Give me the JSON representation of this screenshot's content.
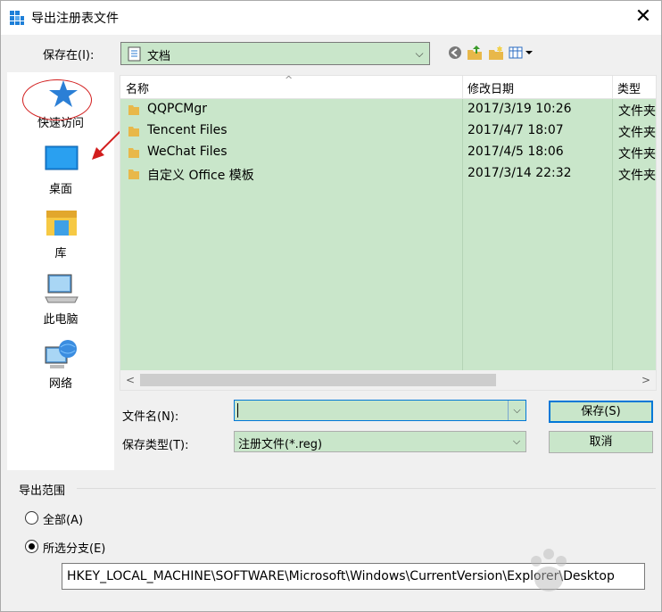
{
  "window": {
    "title": "导出注册表文件",
    "close_glyph": "✕"
  },
  "save_in": {
    "label": "保存在(I):",
    "value": "文档"
  },
  "places": [
    {
      "label": "快速访问",
      "icon": "star-icon"
    },
    {
      "label": "桌面",
      "icon": "desktop-icon"
    },
    {
      "label": "库",
      "icon": "library-icon"
    },
    {
      "label": "此电脑",
      "icon": "computer-icon"
    },
    {
      "label": "网络",
      "icon": "network-icon"
    }
  ],
  "file_list": {
    "columns": [
      "名称",
      "修改日期",
      "类型"
    ],
    "rows": [
      {
        "name": "QQPCMgr",
        "date": "2017/3/19 10:26",
        "type": "文件夹"
      },
      {
        "name": "Tencent Files",
        "date": "2017/4/7 18:07",
        "type": "文件夹"
      },
      {
        "name": "WeChat Files",
        "date": "2017/4/5 18:06",
        "type": "文件夹"
      },
      {
        "name": "自定义 Office 模板",
        "date": "2017/3/14 22:32",
        "type": "文件夹"
      }
    ]
  },
  "filename": {
    "label": "文件名(N):",
    "value": ""
  },
  "filetype": {
    "label": "保存类型(T):",
    "value": "注册文件(*.reg)"
  },
  "buttons": {
    "save": "保存(S)",
    "cancel": "取消"
  },
  "export_range": {
    "title": "导出范围",
    "all_label": "全部(A)",
    "branch_label": "所选分支(E)",
    "selected": "branch",
    "path": "HKEY_LOCAL_MACHINE\\SOFTWARE\\Microsoft\\Windows\\CurrentVersion\\Explorer\\Desktop"
  },
  "colors": {
    "selection_green": "#c9e6ca",
    "accent_blue": "#0078d7",
    "annotation_red": "#d21d1d"
  }
}
